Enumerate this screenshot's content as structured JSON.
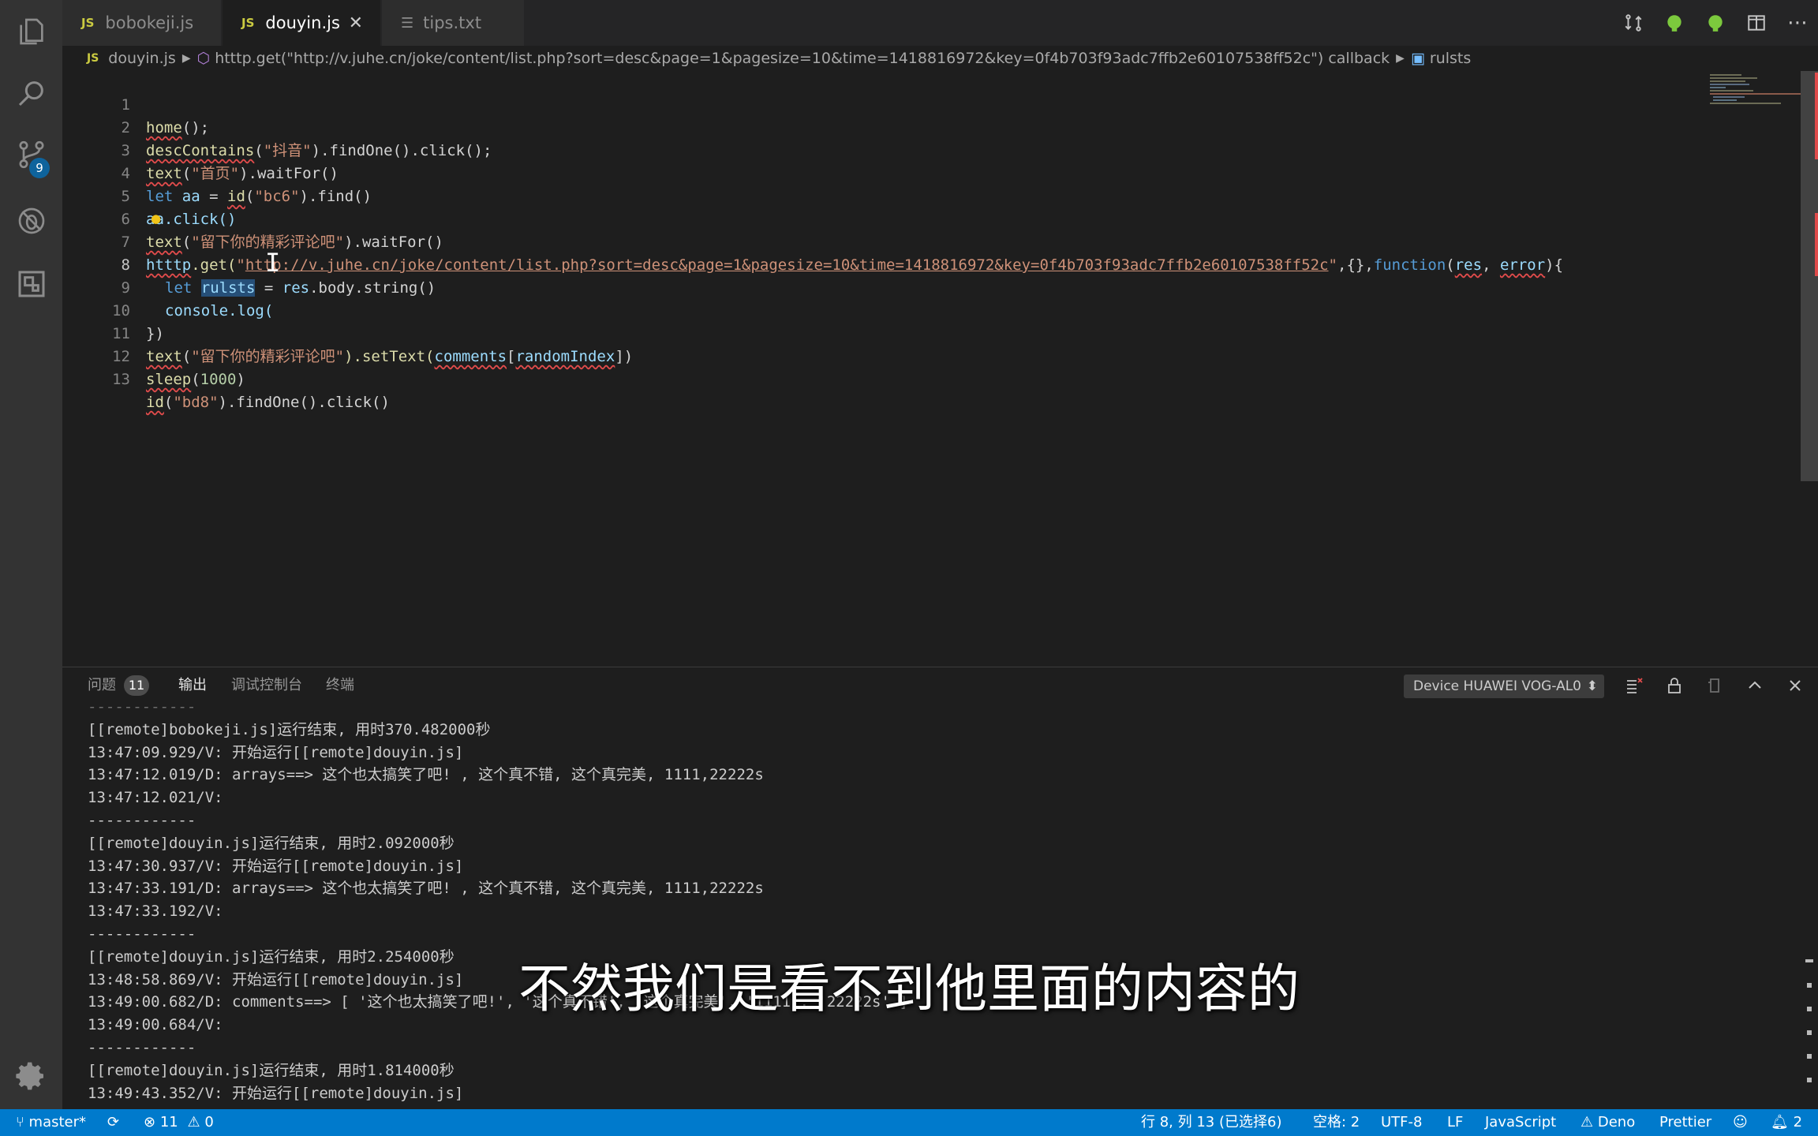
{
  "tabs": [
    {
      "label": "bobokeji.js",
      "type": "js"
    },
    {
      "label": "douyin.js",
      "type": "js",
      "active": true
    },
    {
      "label": "tips.txt",
      "type": "txt"
    }
  ],
  "file_icon": "JS",
  "breadcrumb": {
    "file": "douyin.js",
    "symbol": "htttp.get(\"http://v.juhe.cn/joke/content/list.php?sort=desc&page=1&pagesize=10&time=1418816972&key=0f4b703f93adc7ffb2e60107538ff52c\") callback",
    "variable": "rulsts"
  },
  "activity": {
    "scm_badge": "9"
  },
  "editor": {
    "line_numbers": [
      "1",
      "2",
      "3",
      "4",
      "5",
      "6",
      "7",
      "8",
      "9",
      "10",
      "11",
      "12",
      "13"
    ],
    "l1": {
      "fn": "home",
      "rest": "();"
    },
    "l2": {
      "fn": "descContains",
      "open": "(",
      "str": "\"抖音\"",
      "rest": ").findOne().click();"
    },
    "l3": {
      "fn": "text",
      "open": "(",
      "str": "\"首页\"",
      "rest": ").waitFor()"
    },
    "l4": {
      "kw": "let",
      "var": "aa",
      "eq": " = ",
      "fn": "id",
      "open": "(",
      "str": "\"bc6\"",
      "rest": ").find()"
    },
    "l5": {
      "text": "aa.click()"
    },
    "l6": {
      "fn": "text",
      "open": "(",
      "str": "\"留下你的精彩评论吧\"",
      "rest": ").waitFor()"
    },
    "l7": {
      "obj": "htttp",
      "method": ".get(",
      "q1": "\"",
      "url": "http://v.juhe.cn/joke/content/list.php?sort=desc&page=1&pagesize=10&time=1418816972&key=0f4b703f93adc7ffb2e60107538ff52c",
      "q2": "\"",
      "mid": ",{},",
      "kw": "function",
      "p0": "(",
      "a1": "res",
      "comma": ", ",
      "a2": "error",
      "end": "){"
    },
    "l8": {
      "kw": "let",
      "var": "rulsts",
      "eq": " = ",
      "res": "res",
      "rest": ".body.string()"
    },
    "l9": {
      "text": "console.log("
    },
    "l10": {
      "text": "})"
    },
    "l11": {
      "fn": "text",
      "open": "(",
      "str": "\"留下你的精彩评论吧\"",
      "mid": ").setText(",
      "a": "comments",
      "b": "[",
      "c": "randomIndex",
      "end": "])"
    },
    "l12": {
      "fn": "sleep",
      "open": "(",
      "num": "1000",
      "end": ")"
    },
    "l13": {
      "fn": "id",
      "open": "(",
      "str": "\"bd8\"",
      "rest": ").findOne().click()"
    }
  },
  "panel": {
    "tabs": [
      {
        "label": "问题"
      },
      {
        "label": "输出"
      },
      {
        "label": "调试控制台"
      },
      {
        "label": "终端"
      }
    ],
    "problems_count": "11",
    "device": "Device HUAWEI VOG-AL0",
    "output_lines": [
      "------------",
      "[[remote]bobokeji.js]运行结束, 用时370.482000秒",
      "13:47:09.929/V: 开始运行[[remote]douyin.js]",
      "13:47:12.019/D: arrays==> 这个也太搞笑了吧! , 这个真不错, 这个真完美, 1111,22222s",
      "13:47:12.021/V:",
      "------------",
      "[[remote]douyin.js]运行结束, 用时2.092000秒",
      "13:47:30.937/V: 开始运行[[remote]douyin.js]",
      "13:47:33.191/D: arrays==> 这个也太搞笑了吧! , 这个真不错, 这个真完美, 1111,22222s",
      "13:47:33.192/V:",
      "------------",
      "[[remote]douyin.js]运行结束, 用时2.254000秒",
      "13:48:58.869/V: 开始运行[[remote]douyin.js]",
      "13:49:00.682/D: comments==> [ '这个也太搞笑了吧!', '这个真不错', '这个真完美', '1111', '22222s' ]",
      "13:49:00.684/V:",
      "------------",
      "[[remote]douyin.js]运行结束, 用时1.814000秒",
      "13:49:43.352/V: 开始运行[[remote]douyin.js]"
    ]
  },
  "subtitle": "不然我们是看不到他里面的内容的",
  "status": {
    "branch": "master*",
    "errors": "11",
    "warnings": "0",
    "position": "行 8, 列 13 (已选择6)",
    "spaces": "空格: 2",
    "encoding": "UTF-8",
    "eol": "LF",
    "language": "JavaScript",
    "deno": "Deno",
    "prettier": "Prettier",
    "notifications": "2"
  },
  "colors": {
    "accent": "#007acc",
    "error": "#e04b4b",
    "string": "#ce9178",
    "function": "#dcdcaa",
    "keyword": "#569cd6"
  }
}
